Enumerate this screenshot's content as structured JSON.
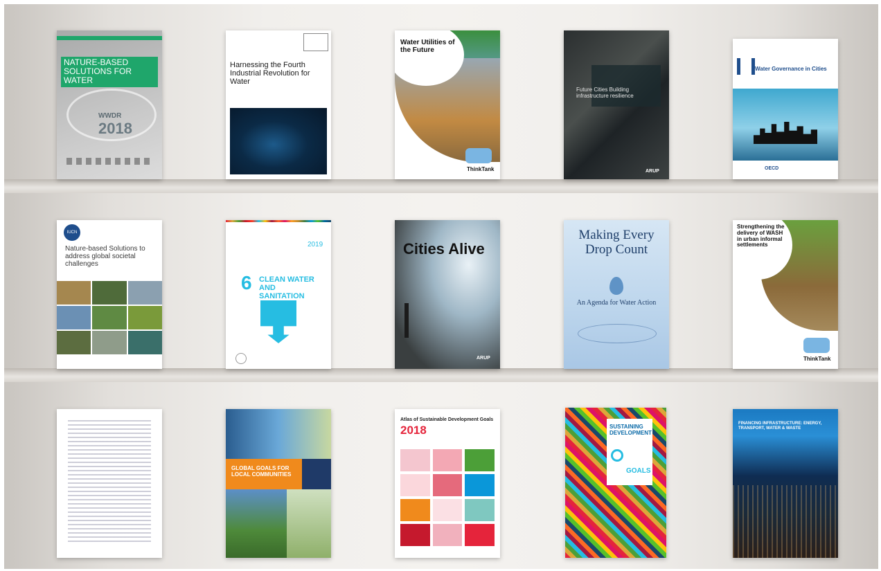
{
  "books": {
    "b1": {
      "banner": "NATURE-BASED SOLUTIONS FOR WATER",
      "edition": "WWDR",
      "year": "2018"
    },
    "b2": {
      "title": "Harnessing the Fourth Industrial Revolution for Water"
    },
    "b3": {
      "title": "Water Utilities of the Future",
      "brand": "ThinkTank"
    },
    "b4": {
      "title": "Future Cities Building infrastructure resilience",
      "publisher": "ARUP"
    },
    "b5": {
      "title": "Water Governance in Cities",
      "publisher": "OECD"
    },
    "b6": {
      "org": "IUCN",
      "title": "Nature-based Solutions to address global societal challenges"
    },
    "b7": {
      "number": "6",
      "title": "CLEAN WATER AND SANITATION",
      "year": "2019"
    },
    "b8": {
      "title": "Cities Alive",
      "publisher": "ARUP"
    },
    "b9": {
      "title": "Making Every Drop Count",
      "subtitle": "An Agenda for Water Action"
    },
    "b10": {
      "title": "Strengthening the delivery of WASH in urban informal settlements",
      "brand": "ThinkTank"
    },
    "b12": {
      "title": "GLOBAL GOALS FOR LOCAL COMMUNITIES"
    },
    "b13": {
      "title": "Atlas of Sustainable Development Goals",
      "year": "2018"
    },
    "b14": {
      "title": "SUSTAINING DEVELOPMENT",
      "goals": "GOALS"
    },
    "b15": {
      "title": "FINANCING INFRASTRUCTURE: ENERGY, TRANSPORT, WATER & WASTE"
    }
  },
  "colors": {
    "accent_green": "#1fa66b",
    "sdg6_blue": "#26bde2",
    "oecd_blue": "#1f4e8c"
  }
}
